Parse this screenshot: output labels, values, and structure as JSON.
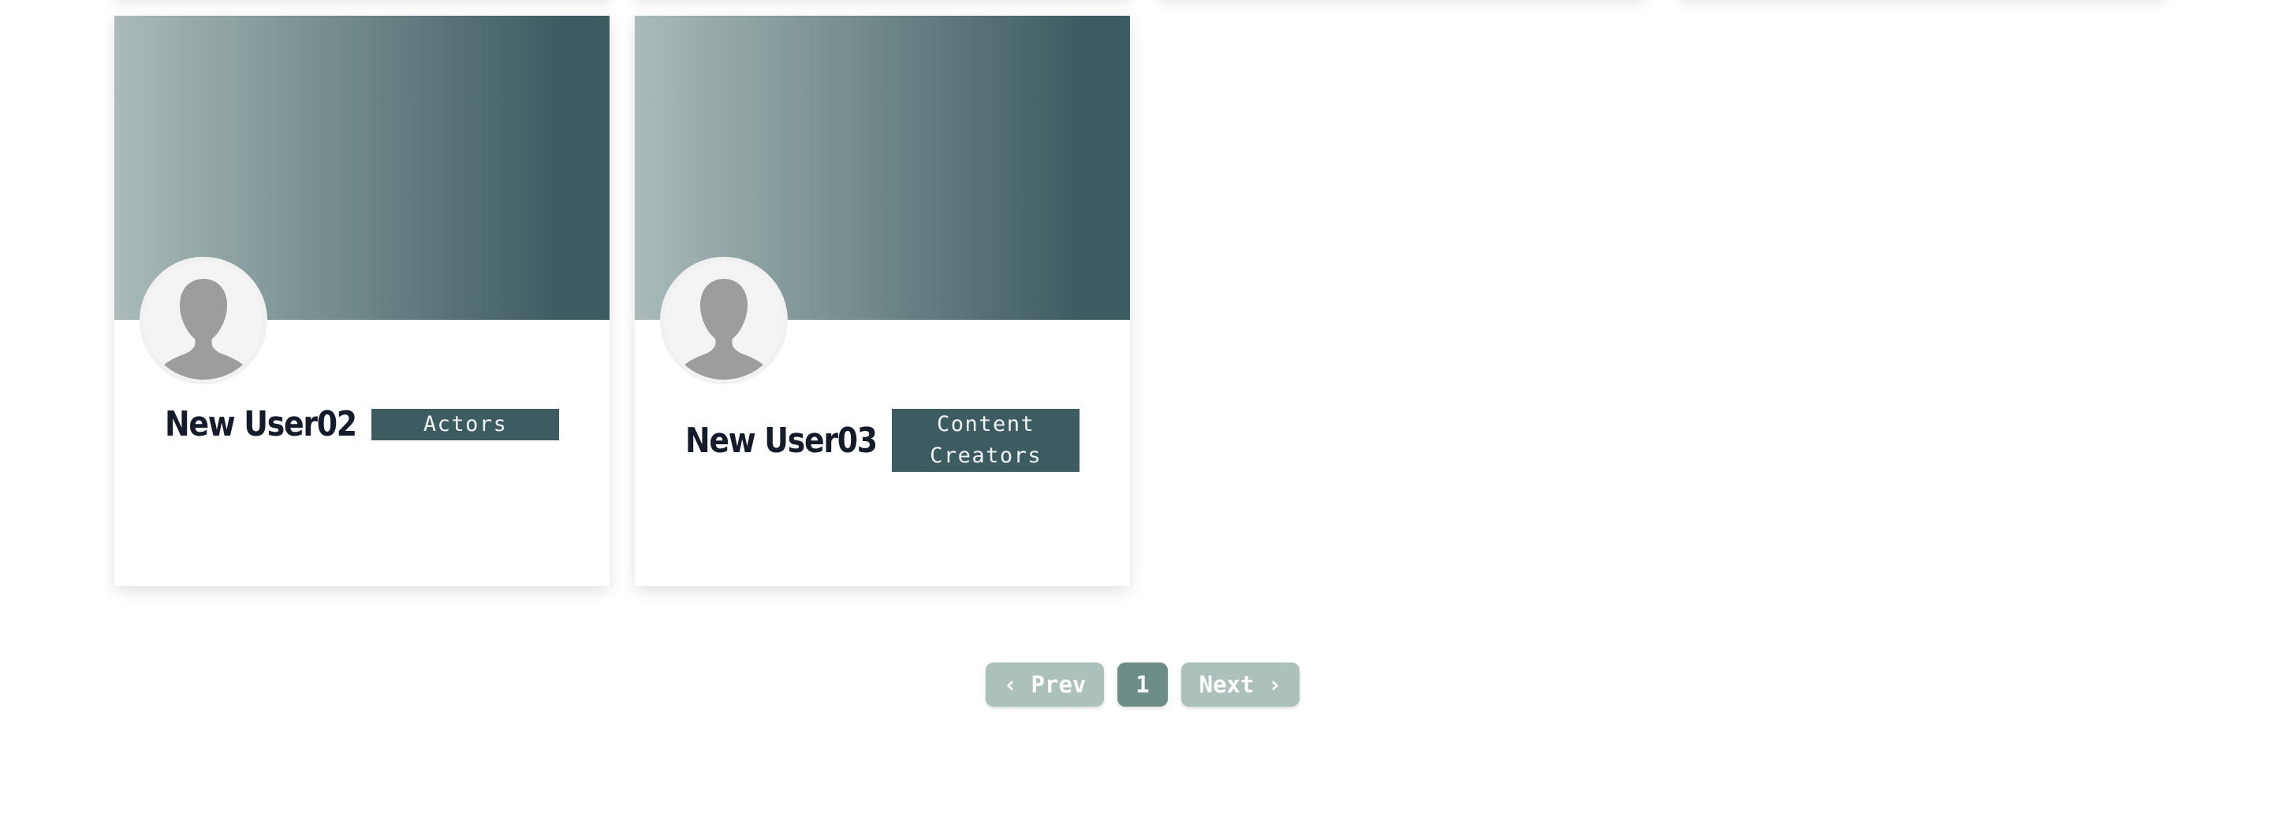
{
  "colors": {
    "banner_gradient_start": "#aabbb9",
    "banner_gradient_end": "#3d5c61",
    "badge_bg": "#3d5c61",
    "name_text": "#141b2b",
    "pager_inactive": "#acc1bc",
    "pager_active": "#6d8e86"
  },
  "cards": [
    {
      "name": "New User02",
      "category": "Actors",
      "avatar_icon": "default-user-silhouette-icon"
    },
    {
      "name": "New User03",
      "category": "Content Creators",
      "avatar_icon": "default-user-silhouette-icon"
    }
  ],
  "pagination": {
    "prev_label": "‹ Prev",
    "current_page": "1",
    "next_label": "Next ›"
  }
}
